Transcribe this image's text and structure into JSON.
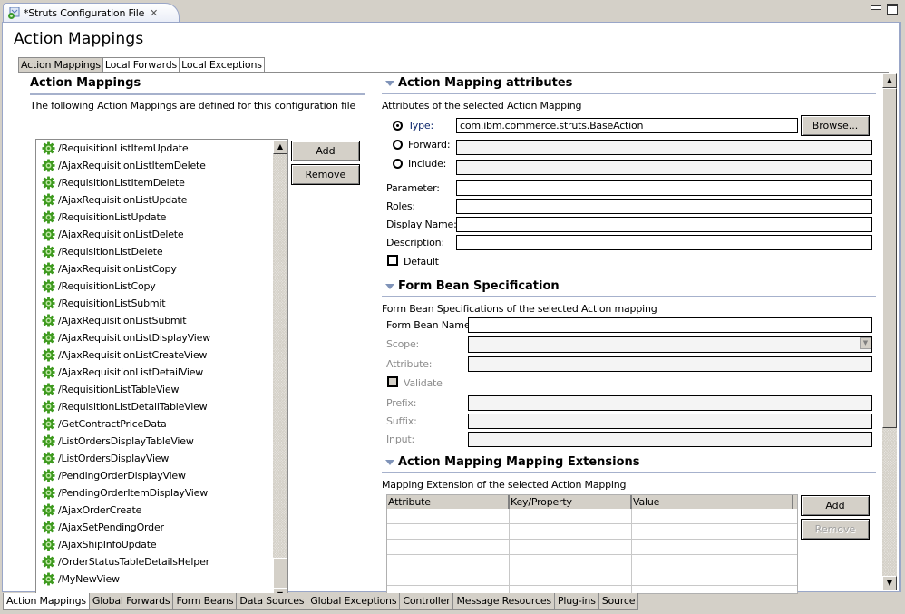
{
  "editor": {
    "tab_title": "*Struts Configuration File",
    "close_glyph": "✕"
  },
  "page": {
    "title": "Action Mappings"
  },
  "inner_tabs": [
    {
      "label": "Action Mappings",
      "active": true
    },
    {
      "label": "Local Forwards",
      "active": false
    },
    {
      "label": "Local Exceptions",
      "active": false
    }
  ],
  "left": {
    "heading": "Action Mappings",
    "description": "The following Action Mappings are defined for this configuration file",
    "add_label": "Add",
    "remove_label": "Remove",
    "items": [
      "/RequisitionListItemUpdate",
      "/AjaxRequisitionListItemDelete",
      "/RequisitionListItemDelete",
      "/AjaxRequisitionListUpdate",
      "/RequisitionListUpdate",
      "/AjaxRequisitionListDelete",
      "/RequisitionListDelete",
      "/AjaxRequisitionListCopy",
      "/RequisitionListCopy",
      "/RequisitionListSubmit",
      "/AjaxRequisitionListSubmit",
      "/AjaxRequisitionListDisplayView",
      "/AjaxRequisitionListCreateView",
      "/AjaxRequisitionListDetailView",
      "/RequisitionListTableView",
      "/RequisitionListDetailTableView",
      "/GetContractPriceData",
      "/ListOrdersDisplayTableView",
      "/ListOrdersDisplayView",
      "/PendingOrderDisplayView",
      "/PendingOrderItemDisplayView",
      "/AjaxOrderCreate",
      "/AjaxSetPendingOrder",
      "/AjaxShipInfoUpdate",
      "/OrderStatusTableDetailsHelper",
      "/MyNewView"
    ]
  },
  "attributes": {
    "heading": "Action Mapping attributes",
    "description": "Attributes of the selected Action Mapping",
    "type_label": "Type:",
    "type_value": "com.ibm.commerce.struts.BaseAction",
    "browse_label": "Browse...",
    "forward_label": "Forward:",
    "forward_value": "",
    "include_label": "Include:",
    "include_value": "",
    "selected_radio": "type",
    "parameter_label": "Parameter:",
    "parameter_value": "",
    "roles_label": "Roles:",
    "roles_value": "",
    "display_name_label": "Display Name:",
    "display_name_value": "",
    "description_label": "Description:",
    "description_value": "",
    "default_label": "Default",
    "default_checked": false
  },
  "form_bean": {
    "heading": "Form Bean Specification",
    "description": "Form Bean Specifications of the selected Action mapping",
    "name_label": "Form Bean Name:",
    "name_value": "",
    "scope_label": "Scope:",
    "scope_value": "",
    "attribute_label": "Attribute:",
    "attribute_value": "",
    "validate_label": "Validate",
    "validate_checked": false,
    "prefix_label": "Prefix:",
    "prefix_value": "",
    "suffix_label": "Suffix:",
    "suffix_value": "",
    "input_label": "Input:",
    "input_value": ""
  },
  "extensions": {
    "heading": "Action Mapping Mapping Extensions",
    "description": "Mapping Extension of the selected Action Mapping",
    "columns": [
      "Attribute",
      "Key/Property",
      "Value"
    ],
    "rows": [],
    "add_label": "Add",
    "remove_label": "Remove"
  },
  "bottom_tabs": [
    {
      "label": "Action Mappings",
      "active": true
    },
    {
      "label": "Global Forwards",
      "active": false
    },
    {
      "label": "Form Beans",
      "active": false
    },
    {
      "label": "Data Sources",
      "active": false
    },
    {
      "label": "Global Exceptions",
      "active": false
    },
    {
      "label": "Controller",
      "active": false
    },
    {
      "label": "Message Resources",
      "active": false
    },
    {
      "label": "Plug-ins",
      "active": false
    },
    {
      "label": "Source",
      "active": false
    }
  ],
  "icons": {
    "list_item": "gear-icon",
    "editor_tab": "struts-config-icon",
    "scroll_up": "▲",
    "scroll_down": "▼",
    "combo_arrow": "▼"
  }
}
